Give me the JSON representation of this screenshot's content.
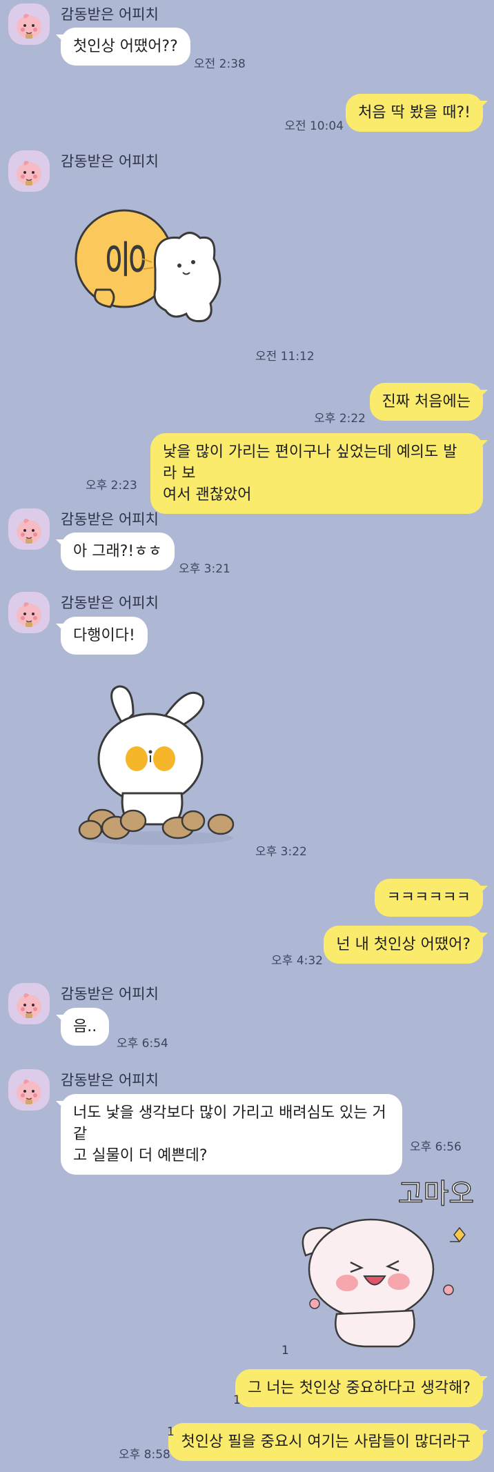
{
  "contact": {
    "name": "감동받은 어피치"
  },
  "messages": [
    {
      "text": "첫인상 어땠어??",
      "time": "오전 2:38"
    },
    {
      "text": "처음 딱 봤을 때?!",
      "time": "오전 10:04"
    },
    {
      "sticker": "sticker-bear-ung",
      "sticker_text": "응",
      "time": "오전 11:12"
    },
    {
      "text": "진짜 처음에는",
      "time": "오후 2:22"
    },
    {
      "text": "낯을 많이 가리는 편이구나 싶었는데 예의도 발라 보\n여서 괜찮았어",
      "time": "오후 2:23"
    },
    {
      "text": "아 그래?!ㅎㅎ",
      "time": "오후 3:21"
    },
    {
      "text": "다행이다!",
      "time": ""
    },
    {
      "sticker": "sticker-bunny-potatoes",
      "time": "오후 3:22"
    },
    {
      "text": "ㅋㅋㅋㅋㅋㅋ",
      "time": ""
    },
    {
      "text": "넌 내 첫인상 어땠어?",
      "time": "오후 4:32"
    },
    {
      "text": "음..",
      "time": "오후 6:54"
    },
    {
      "text": "너도 낯을 생각보다 많이 가리고 배려심도 있는 거 같\n고 실물이 더 예쁜데?",
      "time": "오후 6:56"
    },
    {
      "sticker": "sticker-bunny-thanks",
      "sticker_text": "고마오",
      "unread": "1"
    },
    {
      "text": "그 너는 첫인상 중요하다고 생각해?",
      "unread": "1"
    },
    {
      "text": "첫인상 필을 중요시 여기는 사람들이 많더라구",
      "unread": "1",
      "time": "오후 8:58"
    }
  ]
}
